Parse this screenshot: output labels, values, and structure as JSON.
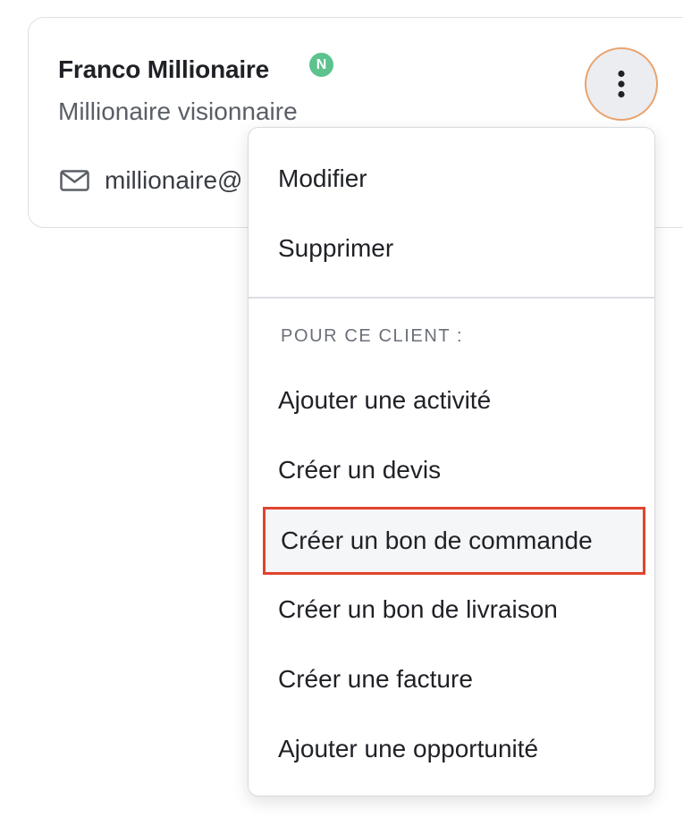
{
  "contact": {
    "name": "Franco Millionaire",
    "badge": "N",
    "title": "Millionaire visionnaire",
    "email": "millionaire@",
    "icons": {
      "email": "mail-icon",
      "more": "vertical-dots-icon"
    }
  },
  "menu": {
    "items_top": [
      "Modifier",
      "Supprimer"
    ],
    "section_header": "POUR CE CLIENT :",
    "items_client": [
      "Ajouter une activité",
      "Créer un devis",
      "Créer un bon de commande",
      "Créer un bon de livraison",
      "Créer une facture",
      "Ajouter une opportunité"
    ],
    "highlighted": "Créer un bon de commande"
  },
  "colors": {
    "badge": "#5cc28e",
    "focus_ring": "#e8a46f",
    "highlight_border": "#e0442e"
  }
}
